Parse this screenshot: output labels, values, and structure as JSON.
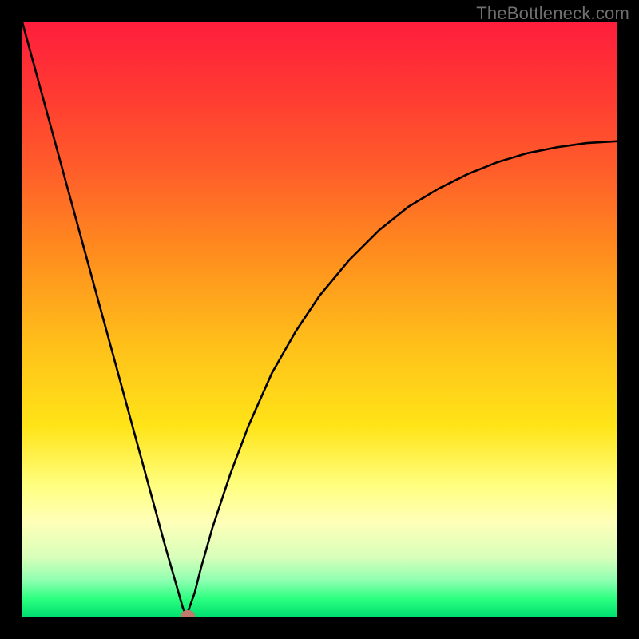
{
  "watermark": "TheBottleneck.com",
  "chart_data": {
    "type": "line",
    "title": "",
    "xlabel": "",
    "ylabel": "",
    "xlim": [
      0,
      100
    ],
    "ylim": [
      0,
      100
    ],
    "grid": false,
    "legend": false,
    "series": [
      {
        "name": "bottleneck-curve",
        "x": [
          0,
          3,
          6,
          9,
          12,
          15,
          18,
          21,
          24,
          26,
          27,
          27.5,
          28,
          29,
          30,
          32,
          35,
          38,
          42,
          46,
          50,
          55,
          60,
          65,
          70,
          75,
          80,
          85,
          90,
          95,
          100
        ],
        "values": [
          100,
          89,
          78,
          67,
          56,
          45,
          34,
          23,
          12,
          5,
          1.5,
          0.3,
          1.2,
          4,
          8,
          15,
          24,
          32,
          41,
          48,
          54,
          60,
          65,
          69,
          72,
          74.5,
          76.5,
          78,
          79,
          79.7,
          80
        ]
      }
    ],
    "marker": {
      "x": 27.8,
      "y": 0.2
    }
  },
  "colors": {
    "curve": "#000000",
    "marker": "#bf7a6d",
    "gradient_top": "#ff1e3c",
    "gradient_bottom": "#00e070",
    "frame": "#000000"
  }
}
